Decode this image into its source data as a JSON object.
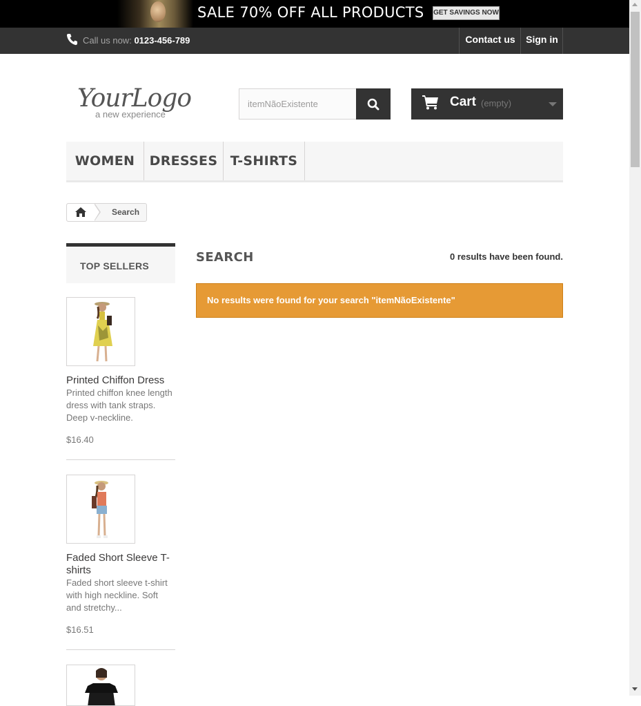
{
  "promo": {
    "sale_text": "SALE 70% OFF ALL PRODUCTS",
    "button_label": "GET SAVINGS NOW"
  },
  "topnav": {
    "call_label": "Call us now:",
    "phone": "0123-456-789",
    "contact_label": "Contact us",
    "signin_label": "Sign in"
  },
  "logo": {
    "text": "YourLogo",
    "tagline": "a new experience"
  },
  "search": {
    "value": "itemNãoExistente",
    "placeholder": "Search"
  },
  "cart": {
    "label": "Cart",
    "status": "(empty)"
  },
  "menu": {
    "items": [
      "WOMEN",
      "DRESSES",
      "T-SHIRTS"
    ]
  },
  "breadcrumb": {
    "current": "Search"
  },
  "sidebar": {
    "title": "TOP SELLERS",
    "products": [
      {
        "name": "Printed Chiffon Dress",
        "description": "Printed chiffon knee length dress with tank straps. Deep v-neckline.",
        "price": "$16.40"
      },
      {
        "name": "Faded Short Sleeve T-shirts",
        "description": "Faded short sleeve t-shirt with high neckline. Soft and stretchy...",
        "price": "$16.51"
      }
    ]
  },
  "main": {
    "title": "SEARCH",
    "results_count": "0 results have been found.",
    "alert": "No results were found for your search \"itemNãoExistente\""
  },
  "colors": {
    "dark": "#333333",
    "alert": "#e69a35",
    "menu_bg": "#f6f6f6"
  }
}
